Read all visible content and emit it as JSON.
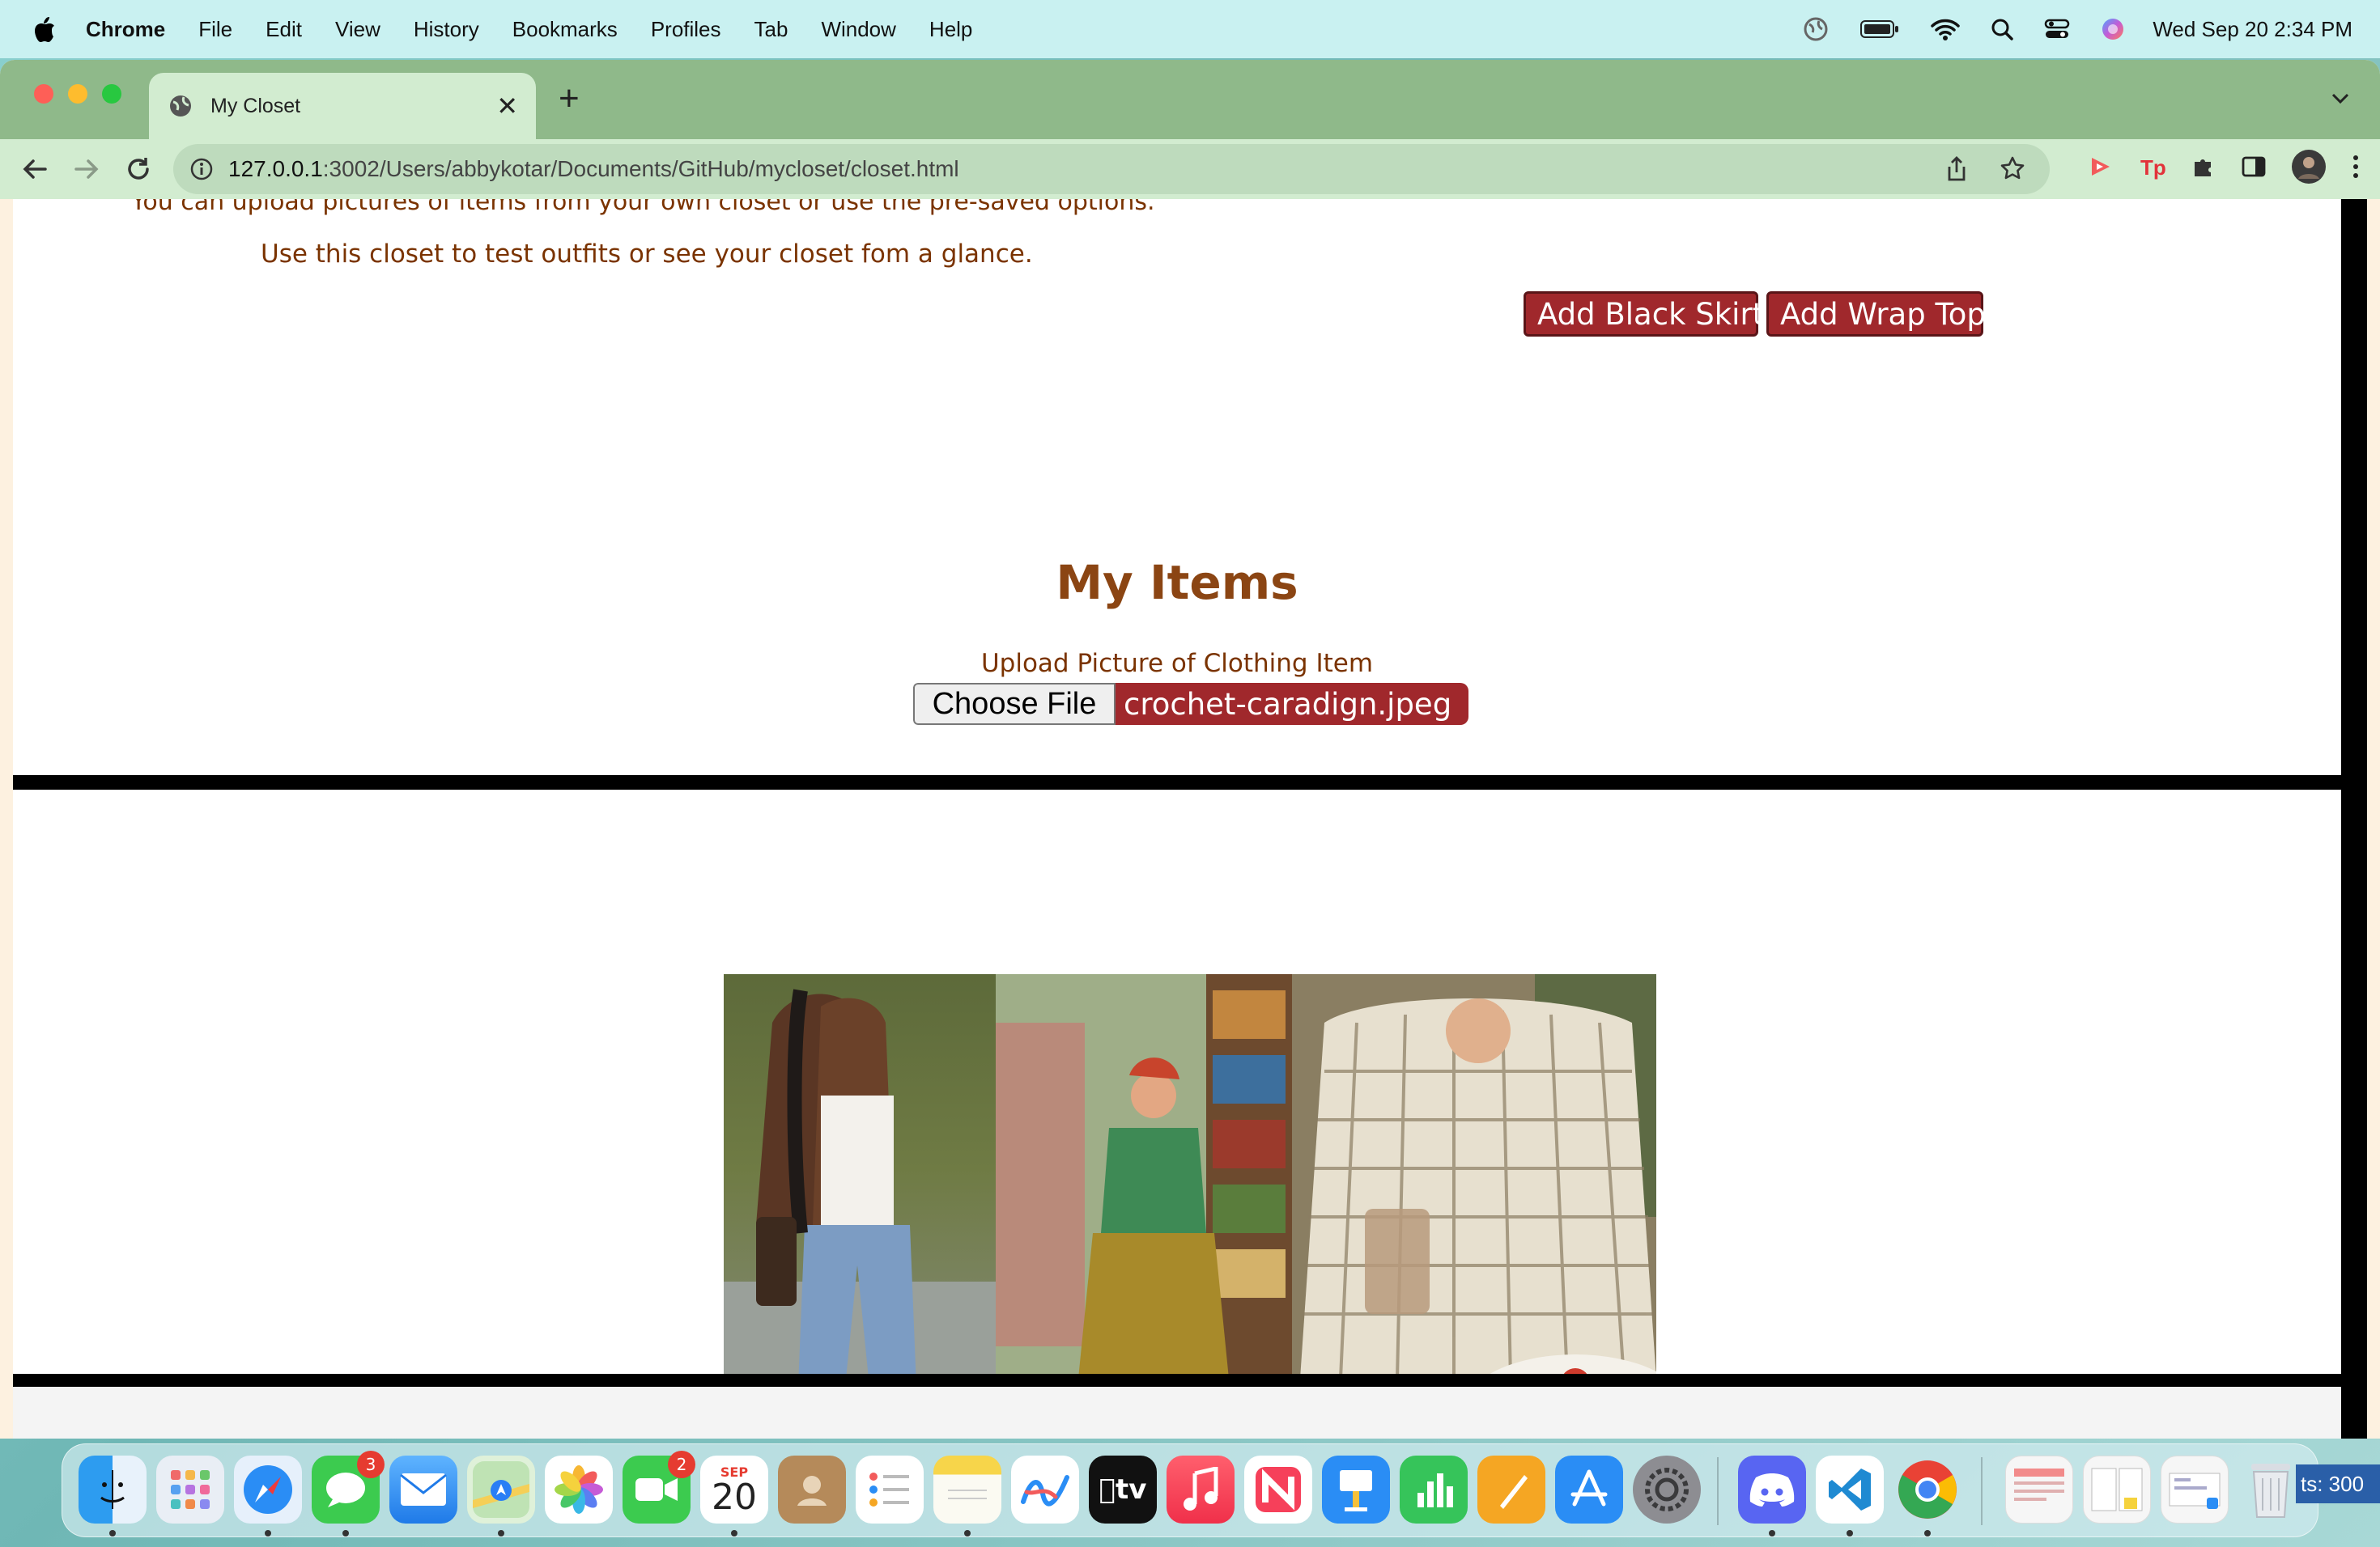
{
  "menubar": {
    "app_name": "Chrome",
    "items": [
      "File",
      "Edit",
      "View",
      "History",
      "Bookmarks",
      "Profiles",
      "Tab",
      "Window",
      "Help"
    ],
    "clock": "Wed Sep 20  2:34 PM",
    "status_icons": [
      "globe-icon",
      "battery-icon",
      "wifi-icon",
      "spotlight-icon",
      "control-center-icon",
      "siri-icon"
    ]
  },
  "browser": {
    "tab_title": "My Closet",
    "url_host": "127.0.0.1",
    "url_path": ":3002/Users/abbykotar/Documents/GitHub/mycloset/closet.html",
    "colors": {
      "tabstrip": "#8fb98a",
      "toolbar": "#d2ecd0",
      "omnibox": "#bedbbd"
    }
  },
  "page": {
    "intro_line_1": "You can upload pictures of items from your own closet or use the pre-saved options.",
    "intro_line_2": "Use this closet to test outfits or see your closet fom a glance.",
    "buttons": {
      "add_black_skirt": "Add Black Skirt",
      "add_wrap_top": "Add Wrap Top"
    },
    "section_title": "My Items",
    "upload_label": "Upload Picture of Clothing Item",
    "file_input": {
      "button_label": "Choose File",
      "file_name": "crochet-caradign.jpeg"
    },
    "colors": {
      "text_brown": "#7a3300",
      "title_brown": "#8b4513",
      "button_red": "#a0282c"
    }
  },
  "dock": {
    "apps": [
      {
        "name": "Finder",
        "icon": "finder-icon"
      },
      {
        "name": "Launchpad",
        "icon": "launchpad-icon"
      },
      {
        "name": "Safari",
        "icon": "safari-icon"
      },
      {
        "name": "Messages",
        "icon": "messages-icon",
        "badge": "3"
      },
      {
        "name": "Mail",
        "icon": "mail-icon"
      },
      {
        "name": "Maps",
        "icon": "maps-icon"
      },
      {
        "name": "Photos",
        "icon": "photos-icon"
      },
      {
        "name": "FaceTime",
        "icon": "facetime-icon",
        "badge": "2"
      },
      {
        "name": "Calendar",
        "icon": "calendar-icon",
        "month": "SEP",
        "day": "20"
      },
      {
        "name": "Contacts",
        "icon": "contacts-icon"
      },
      {
        "name": "Reminders",
        "icon": "reminders-icon"
      },
      {
        "name": "Notes",
        "icon": "notes-icon"
      },
      {
        "name": "Freeform",
        "icon": "freeform-icon"
      },
      {
        "name": "TV",
        "icon": "tv-icon",
        "label": "tv"
      },
      {
        "name": "Music",
        "icon": "music-icon"
      },
      {
        "name": "News",
        "icon": "news-icon"
      },
      {
        "name": "Keynote",
        "icon": "keynote-icon"
      },
      {
        "name": "Numbers",
        "icon": "numbers-icon"
      },
      {
        "name": "Pages",
        "icon": "pages-icon"
      },
      {
        "name": "App Store",
        "icon": "app-store-icon"
      },
      {
        "name": "System Settings",
        "icon": "settings-icon"
      },
      {
        "name": "Discord",
        "icon": "discord-icon"
      },
      {
        "name": "VS Code",
        "icon": "vscode-icon"
      },
      {
        "name": "Chrome",
        "icon": "chrome-icon"
      }
    ],
    "right_edge_text": "ts: 300"
  }
}
